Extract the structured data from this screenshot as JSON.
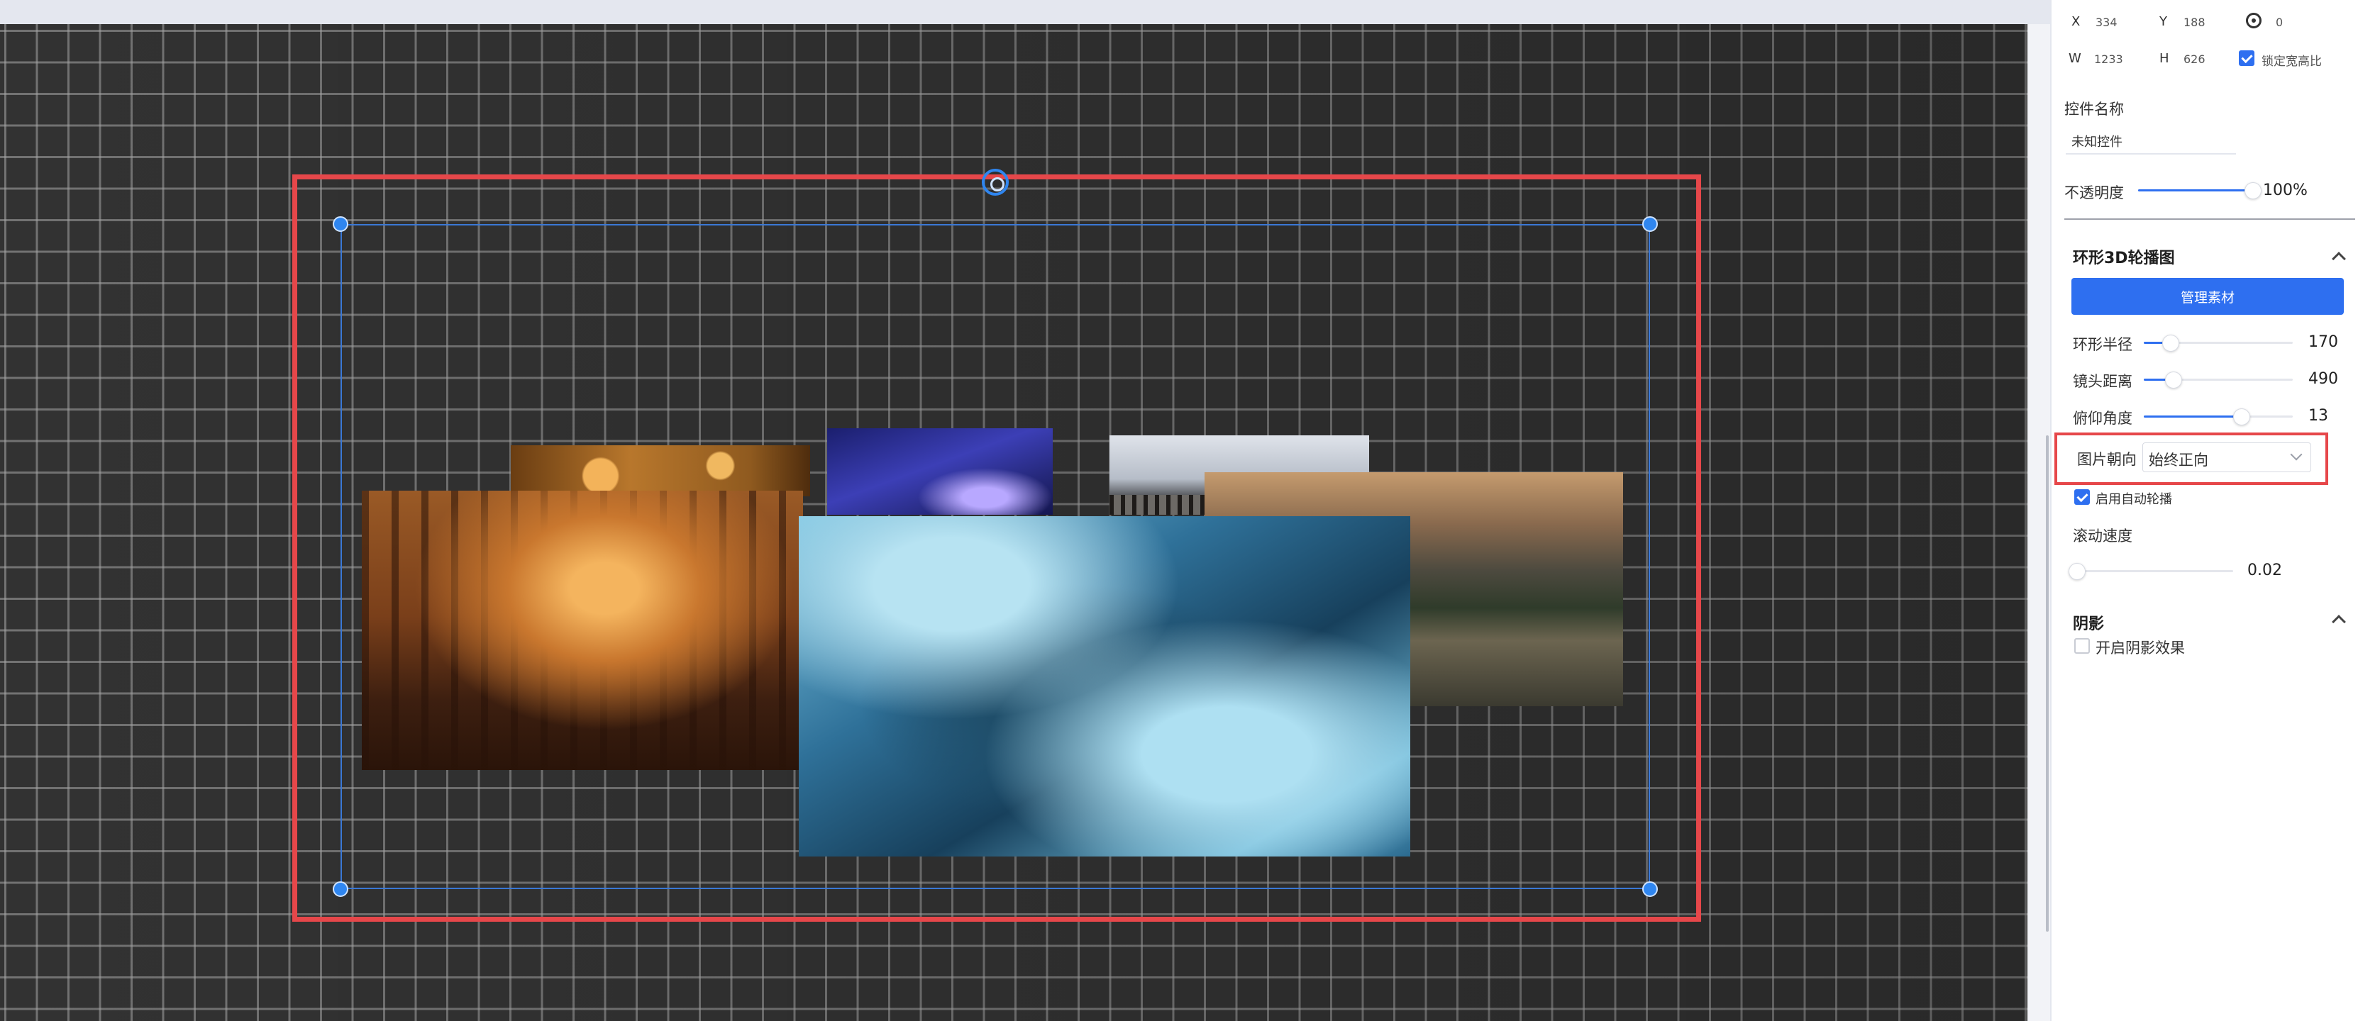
{
  "geometry": {
    "x_label": "X",
    "x_value": "334",
    "y_label": "Y",
    "y_value": "188",
    "rotation_value": "0",
    "w_label": "W",
    "w_value": "1233",
    "h_label": "H",
    "h_value": "626",
    "lock_ratio_label": "锁定宽高比",
    "lock_ratio_checked": true
  },
  "control": {
    "name_label": "控件名称",
    "name_value": "未知控件",
    "opacity_label": "不透明度",
    "opacity_value": "100%",
    "opacity_fraction": 1.0
  },
  "carousel_section": {
    "title": "环形3D轮播图",
    "manage_button": "管理素材",
    "radius_label": "环形半径",
    "radius_value": "170",
    "camera_distance_label": "镜头距离",
    "camera_distance_value": "490",
    "pitch_label": "俯仰角度",
    "pitch_value": "13",
    "orientation_label": "图片朝向",
    "orientation_value": "始终正向",
    "autoplay_label": "启用自动轮播",
    "autoplay_checked": true,
    "scroll_speed_label": "滚动速度",
    "scroll_speed_value": "0.02"
  },
  "shadow_section": {
    "title": "阴影",
    "enable_label": "开启阴影效果",
    "enable_checked": false
  },
  "colors": {
    "accent": "#2e6ff0",
    "selection_outline": "#e6474a",
    "canvas_bg": "#323232"
  }
}
